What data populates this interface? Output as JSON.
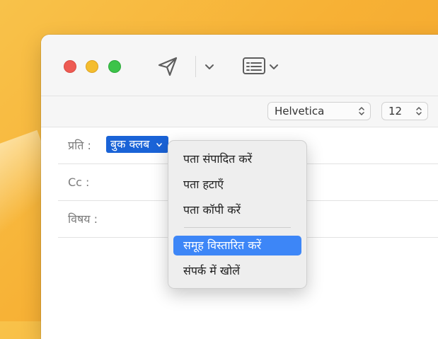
{
  "toolbar": {
    "send_icon": "paper-plane-icon",
    "send_menu_icon": "chevron-down-icon",
    "header_fields_icon": "header-fields-icon",
    "header_menu_icon": "chevron-down-icon"
  },
  "format_bar": {
    "font_family": "Helvetica",
    "font_size": "12"
  },
  "compose": {
    "to_label": "प्रति :",
    "to_recipient": "बुक क्लब",
    "cc_label": "Cc :",
    "subject_label": "विषय :"
  },
  "context_menu": {
    "items": [
      {
        "label": "पता संपादित करें",
        "highlighted": false
      },
      {
        "label": "पता हटाएँ",
        "highlighted": false
      },
      {
        "label": "पता कॉपी करें",
        "highlighted": false
      },
      {
        "label": "समूह विस्तारित करें",
        "highlighted": true
      },
      {
        "label": "संपर्क में खोलें",
        "highlighted": false
      }
    ]
  },
  "colors": {
    "selection": "#1a63d7",
    "menu_highlight": "#3d86f7",
    "close": "#ee5b53",
    "minimize": "#f4bd2f",
    "maximize": "#3dc34a"
  }
}
